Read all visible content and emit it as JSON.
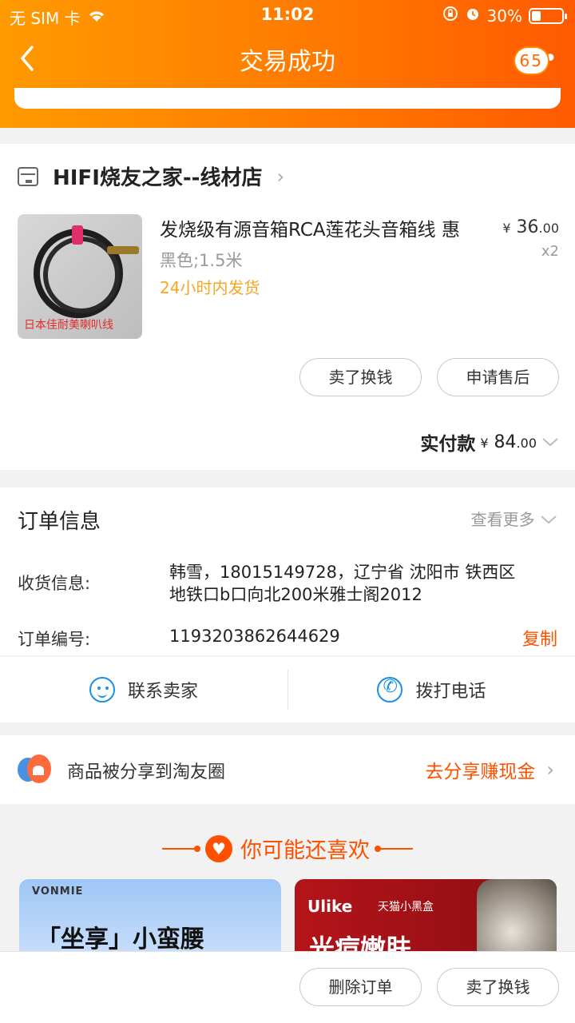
{
  "status_bar": {
    "carrier": "无 SIM 卡",
    "time": "11:02",
    "battery": "30%",
    "battery_level": 0.3
  },
  "nav": {
    "title": "交易成功",
    "badge": "65"
  },
  "shop": {
    "name": "HIFI烧友之家--线材店",
    "product": {
      "title": "发烧级有源音箱RCA莲花头音箱线 惠",
      "spec": "黑色;1.5米",
      "shipping": "24小时内发货",
      "price_symbol": "¥",
      "price_int": "36",
      "price_dec": ".00",
      "quantity": "x2",
      "image_watermark": "日本佳耐美喇叭线"
    },
    "buttons": {
      "sell": "卖了换钱",
      "after_sale": "申请售后"
    },
    "paid": {
      "label": "实付款",
      "symbol": "¥",
      "int": "84",
      "dec": ".00"
    }
  },
  "order_info": {
    "title": "订单信息",
    "more": "查看更多",
    "address_label": "收货信息:",
    "address_line1": "韩雪，18015149728，辽宁省 沈阳市 铁西区",
    "address_line2": "地铁口b口向北200米雅士阁2012",
    "order_no_label": "订单编号:",
    "order_no": "1193203862644629",
    "copy": "复制"
  },
  "contact": {
    "seller": "联系卖家",
    "call": "拨打电话"
  },
  "share": {
    "text": "商品被分享到淘友圈",
    "link": "去分享赚现金"
  },
  "recommend": {
    "title": "你可能还喜欢",
    "items": [
      {
        "brand": "VONMIE",
        "text": "「坐享」小蛮腰"
      },
      {
        "brand": "Ulike",
        "sub": "天猫小黑盒",
        "text": "光痘嫩肤"
      }
    ]
  },
  "bottom": {
    "delete": "删除订单",
    "sell": "卖了换钱"
  }
}
